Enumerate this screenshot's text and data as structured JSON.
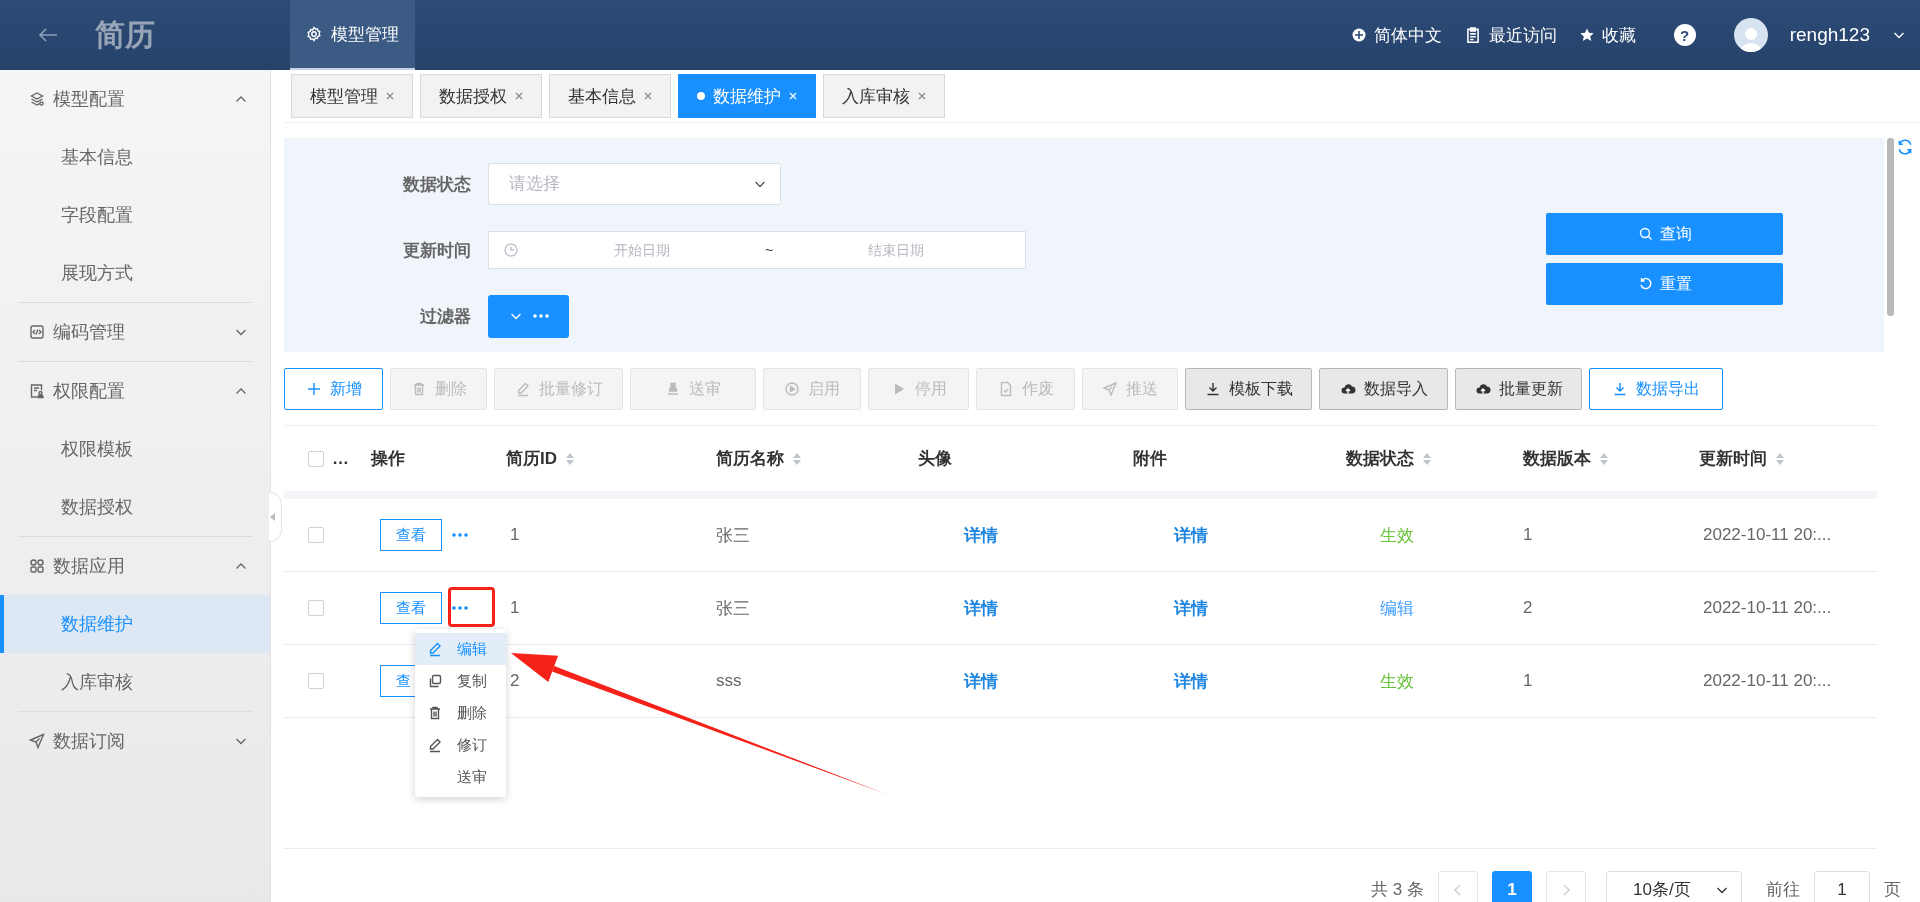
{
  "header": {
    "title": "简历",
    "nav": [
      {
        "label": "模型管理",
        "selected": true
      }
    ],
    "links": [
      {
        "kind": "language",
        "label": "简体中文"
      },
      {
        "kind": "recent",
        "label": "最近访问"
      },
      {
        "kind": "favorite",
        "label": "收藏"
      }
    ],
    "help": "?",
    "user": "rengh123"
  },
  "sidebar": {
    "groups": [
      {
        "kind": "model",
        "label": "模型配置",
        "expanded": true,
        "children": [
          {
            "label": "基本信息",
            "selected": false
          },
          {
            "label": "字段配置",
            "selected": false
          },
          {
            "label": "展现方式",
            "selected": false
          }
        ]
      },
      {
        "kind": "code",
        "label": "编码管理",
        "expanded": false
      },
      {
        "kind": "permission",
        "label": "权限配置",
        "expanded": true,
        "children": [
          {
            "label": "权限模板",
            "selected": false
          },
          {
            "label": "数据授权",
            "selected": false
          }
        ]
      },
      {
        "kind": "app",
        "label": "数据应用",
        "expanded": true,
        "children": [
          {
            "label": "数据维护",
            "selected": true
          },
          {
            "label": "入库审核",
            "selected": false
          }
        ]
      },
      {
        "kind": "subscribe",
        "label": "数据订阅",
        "expanded": false
      }
    ]
  },
  "tabs": [
    {
      "label": "模型管理",
      "selected": false
    },
    {
      "label": "数据授权",
      "selected": false
    },
    {
      "label": "基本信息",
      "selected": false
    },
    {
      "label": "数据维护",
      "selected": true
    },
    {
      "label": "入库审核",
      "selected": false
    }
  ],
  "filters": {
    "status": {
      "label": "数据状态",
      "placeholder": "请选择"
    },
    "time": {
      "label": "更新时间",
      "start_placeholder": "开始日期",
      "separator": "~",
      "end_placeholder": "结束日期"
    },
    "filter": {
      "label": "过滤器"
    },
    "actions": [
      {
        "kind": "search",
        "label": "查询"
      },
      {
        "kind": "reset",
        "label": "重置"
      }
    ]
  },
  "toolbar": [
    {
      "label": "新增",
      "disabled": false
    },
    {
      "label": "删除",
      "disabled": true
    },
    {
      "label": "批量修订",
      "disabled": true
    },
    {
      "label": "送审",
      "disabled": true
    },
    {
      "label": "启用",
      "disabled": true
    },
    {
      "label": "停用",
      "disabled": true
    },
    {
      "label": "作废",
      "disabled": true
    },
    {
      "label": "推送",
      "disabled": true
    },
    {
      "label": "模板下载",
      "disabled": false
    },
    {
      "label": "数据导入",
      "disabled": false
    },
    {
      "label": "批量更新",
      "disabled": false
    },
    {
      "label": "数据导出",
      "disabled": false
    }
  ],
  "table": {
    "select_label": "…",
    "select_all_checked": false,
    "columns": [
      {
        "label": "操作",
        "sortable": false
      },
      {
        "label": "简历ID",
        "sortable": true
      },
      {
        "label": "简历名称",
        "sortable": true
      },
      {
        "label": "头像",
        "sortable": false
      },
      {
        "label": "附件",
        "sortable": false
      },
      {
        "label": "数据状态",
        "sortable": true
      },
      {
        "label": "数据版本",
        "sortable": true
      },
      {
        "label": "更新时间",
        "sortable": true
      }
    ],
    "rows": [
      {
        "checked": false,
        "view": "查看",
        "more": true,
        "marked": false,
        "id": "1",
        "name": "张三",
        "avatar": "详情",
        "attachment": "详情",
        "status": "生效",
        "color": "#67c23a",
        "version": "1",
        "updated": "2022-10-11 20:..."
      },
      {
        "checked": false,
        "view": "查看",
        "more": true,
        "marked": true,
        "id": "1",
        "name": "张三",
        "avatar": "详情",
        "attachment": "详情",
        "status": "编辑",
        "color": "#409eff",
        "version": "2",
        "updated": "2022-10-11 20:..."
      },
      {
        "checked": false,
        "view": "查",
        "more": false,
        "marked": false,
        "id": "2",
        "name": "sss",
        "avatar": "详情",
        "attachment": "详情",
        "status": "生效",
        "color": "#67c23a",
        "version": "1",
        "updated": "2022-10-11 20:..."
      }
    ],
    "menu": [
      {
        "label": "编辑",
        "selected": true
      },
      {
        "label": "复制",
        "selected": false
      },
      {
        "label": "删除",
        "selected": false
      },
      {
        "label": "修订",
        "selected": false
      },
      {
        "label": "送审",
        "selected": false
      }
    ]
  },
  "pagination": {
    "total": "共 3 条",
    "pages": [
      {
        "label": "1",
        "selected": true
      }
    ],
    "page_size": "10条/页",
    "goto_label": "前往",
    "goto_value": "1",
    "page_unit": "页"
  }
}
